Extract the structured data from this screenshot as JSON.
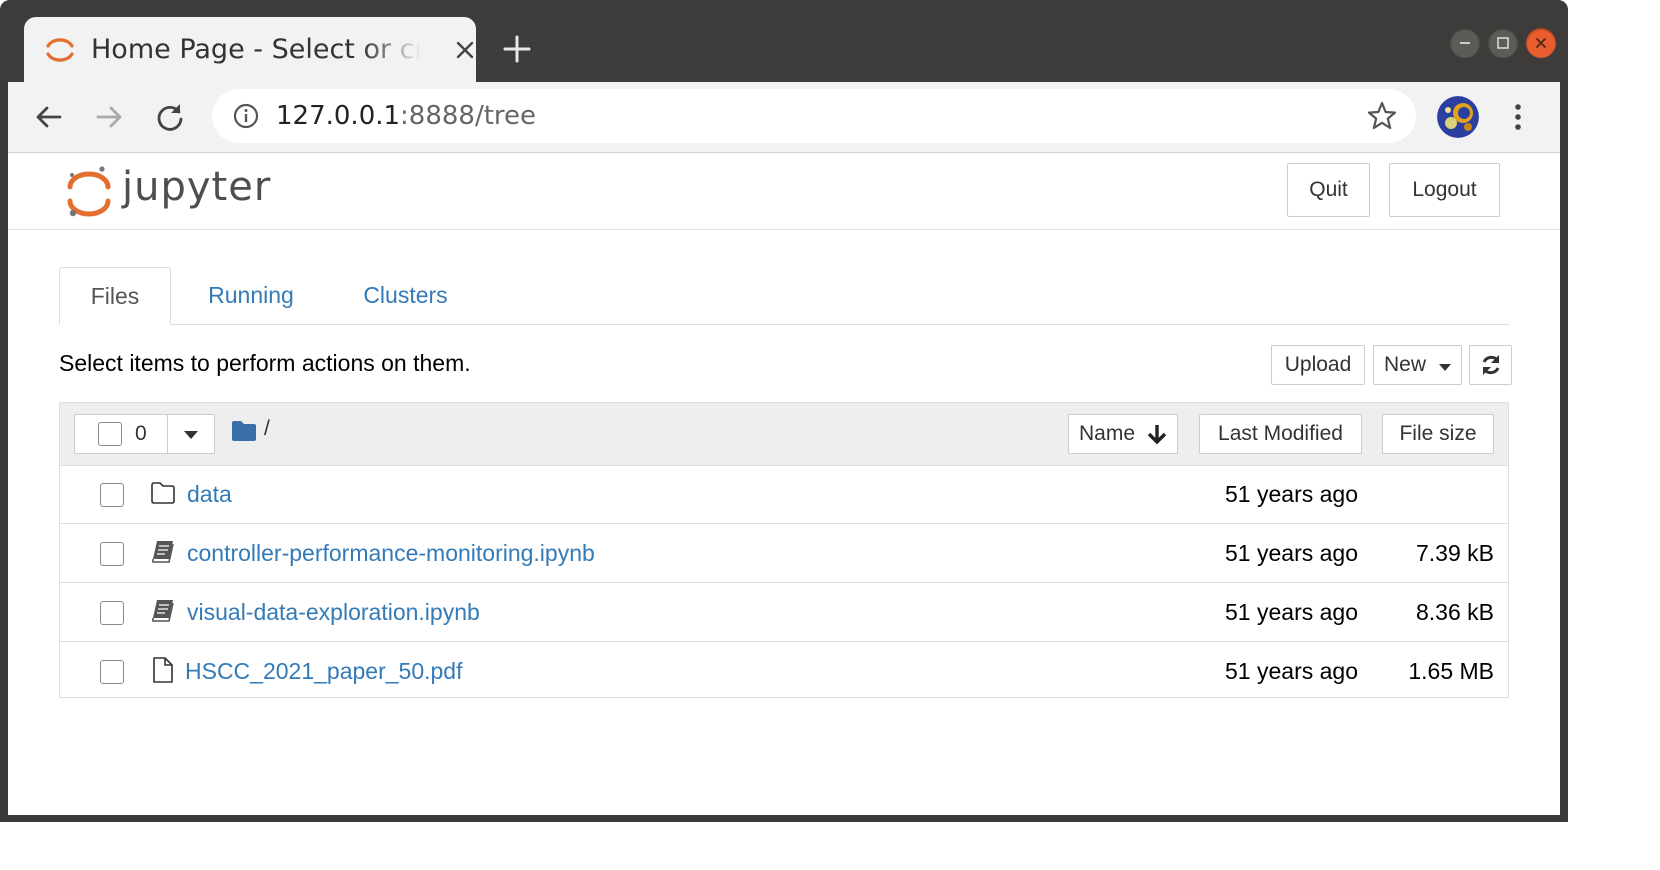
{
  "browser": {
    "tab_title": "Home Page - Select or create a notebook",
    "url_host": "127.0.0.1",
    "url_rest": ":8888/tree"
  },
  "header": {
    "logo_text": "jupyter",
    "quit_label": "Quit",
    "logout_label": "Logout"
  },
  "tabs": [
    {
      "label": "Files",
      "active": true
    },
    {
      "label": "Running",
      "active": false
    },
    {
      "label": "Clusters",
      "active": false
    }
  ],
  "toolbar": {
    "hint": "Select items to perform actions on them.",
    "upload_label": "Upload",
    "new_label": "New"
  },
  "list_header": {
    "selected_count": "0",
    "breadcrumb": "/",
    "sort_name_label": "Name",
    "sort_modified_label": "Last Modified",
    "sort_size_label": "File size"
  },
  "items": [
    {
      "name": "data",
      "type": "folder",
      "modified": "51 years ago",
      "size": ""
    },
    {
      "name": "controller-performance-monitoring.ipynb",
      "type": "notebook",
      "modified": "51 years ago",
      "size": "7.39 kB"
    },
    {
      "name": "visual-data-exploration.ipynb",
      "type": "notebook",
      "modified": "51 years ago",
      "size": "8.36 kB"
    },
    {
      "name": "HSCC_2021_paper_50.pdf",
      "type": "file",
      "modified": "51 years ago",
      "size": "1.65 MB"
    }
  ],
  "colors": {
    "link": "#337ab7",
    "jupyter_orange": "#e46e2e",
    "close_button": "#e95d2f"
  }
}
